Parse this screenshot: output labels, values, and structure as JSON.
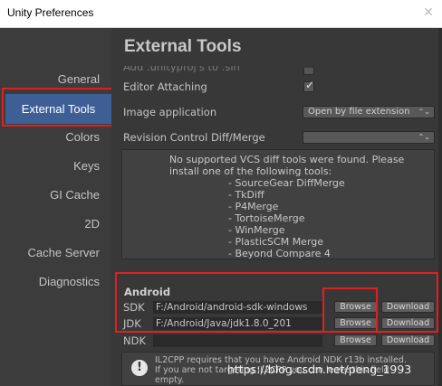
{
  "window": {
    "title": "Unity Preferences"
  },
  "sidebar": {
    "items": [
      {
        "label": "General"
      },
      {
        "label": "External Tools"
      },
      {
        "label": "Colors"
      },
      {
        "label": "Keys"
      },
      {
        "label": "GI Cache"
      },
      {
        "label": "2D"
      },
      {
        "label": "Cache Server"
      },
      {
        "label": "Diagnostics"
      }
    ],
    "selected": "External Tools"
  },
  "main": {
    "heading": "External Tools",
    "cutoff_label": "Add .unityproj's to .sln",
    "editor_attaching": {
      "label": "Editor Attaching",
      "checked": true,
      "check_glyph": "✓"
    },
    "image_application": {
      "label": "Image application",
      "value": "Open by file extension",
      "arrow": "⌃⌄"
    },
    "revision_control": {
      "label": "Revision Control Diff/Merge",
      "value": "",
      "arrow": "⌃⌄"
    },
    "help_lines": [
      "No supported VCS diff tools were found. Please",
      "install one of the following tools:",
      "- SourceGear DiffMerge",
      "- TkDiff",
      "- P4Merge",
      "- TortoiseMerge",
      "- WinMerge",
      "- PlasticSCM Merge",
      "- Beyond Compare 4"
    ]
  },
  "android": {
    "section_label": "Android",
    "sdk": {
      "label": "SDK",
      "path": "F:/Android/android-sdk-windows",
      "browse": "Browse",
      "download": "Download"
    },
    "jdk": {
      "label": "JDK",
      "path": "F:/Android/Java/jdk1.8.0_201",
      "browse": "Browse",
      "download": "Download"
    },
    "ndk": {
      "label": "NDK",
      "path": "",
      "browse": "Browse",
      "download": "Download"
    },
    "ndk_notice": {
      "icon": "!",
      "lines": [
        "IL2CPP requires that you have Android NDK r13b installed.",
        "If you are not targeting IL2CPP you can leave this field",
        "empty."
      ]
    }
  },
  "watermark": "https://blog.csdn.net/peng_1993",
  "colors": {
    "accent": "#3e5f96",
    "annotation": "#e02020",
    "panel": "#383838",
    "sidebar": "#3c3c3c"
  }
}
